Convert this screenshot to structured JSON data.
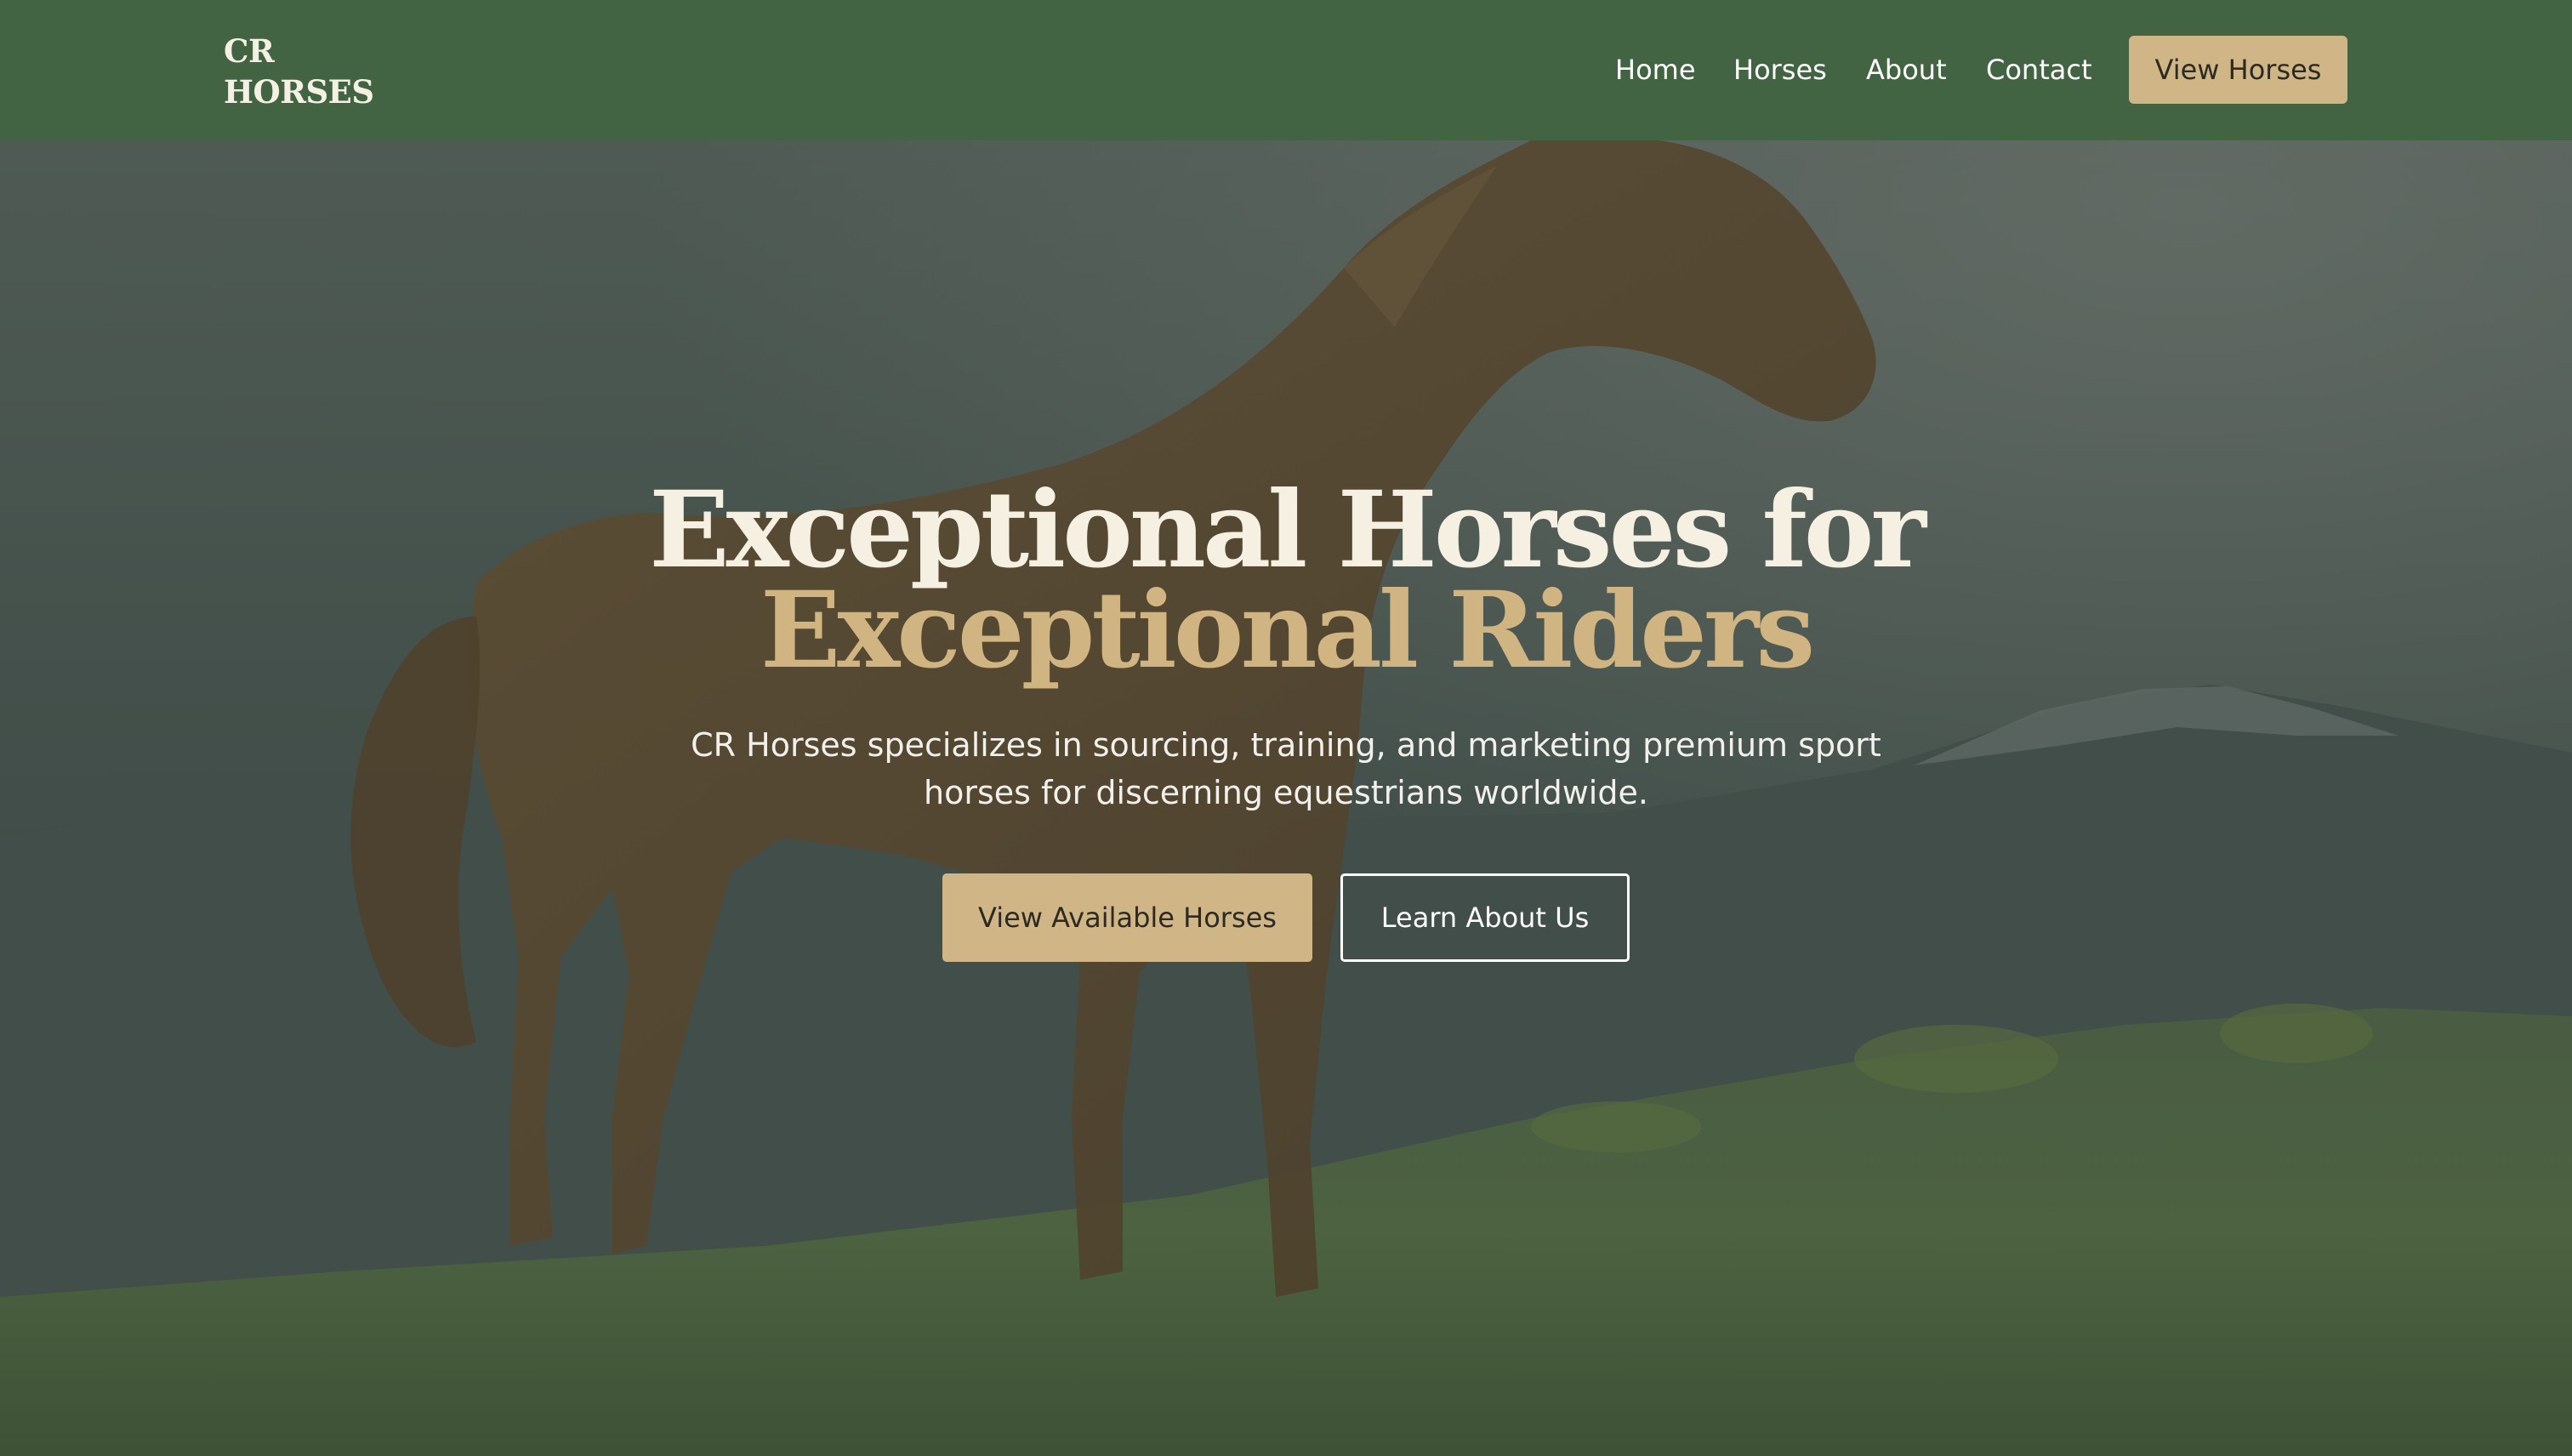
{
  "brand": {
    "line1": "CR",
    "line2": "HORSES"
  },
  "nav": {
    "items": [
      {
        "label": "Home"
      },
      {
        "label": "Horses"
      },
      {
        "label": "About"
      },
      {
        "label": "Contact"
      }
    ],
    "cta_label": "View Horses"
  },
  "hero": {
    "title_line1": "Exceptional Horses for",
    "title_line2": "Exceptional Riders",
    "subtitle": "CR Horses specializes in sourcing, training, and marketing premium sport horses for discerning equestrians worldwide.",
    "primary_cta": "View Available Horses",
    "secondary_cta": "Learn About Us"
  },
  "colors": {
    "nav_bg": "#426442",
    "accent_gold": "#d0b686",
    "title_cream": "#f5f0e2",
    "title_gold": "#d0b582"
  }
}
